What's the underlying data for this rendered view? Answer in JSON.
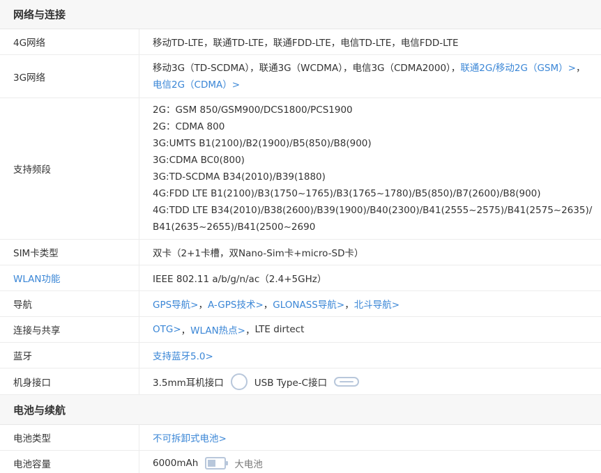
{
  "sections": {
    "network": {
      "title": "网络与连接"
    },
    "battery": {
      "title": "电池与续航"
    }
  },
  "rows": {
    "lte": {
      "label": "4G网络",
      "value": "移动TD-LTE，联通TD-LTE，联通FDD-LTE，电信TD-LTE，电信FDD-LTE"
    },
    "g3": {
      "label": "3G网络",
      "text": "移动3G（TD-SCDMA），联通3G（WCDMA），电信3G（CDMA2000），",
      "link1": "联通2G/移动2G（GSM）>",
      "sep": "，",
      "link2": "电信2G（CDMA）>"
    },
    "bands": {
      "label": "支持频段",
      "lines": [
        "2G：GSM 850/GSM900/DCS1800/PCS1900",
        "2G：CDMA 800",
        "3G:UMTS B1(2100)/B2(1900)/B5(850)/B8(900)",
        "3G:CDMA BC0(800)",
        "3G:TD-SCDMA B34(2010)/B39(1880)",
        "4G:FDD LTE B1(2100)/B3(1750~1765)/B3(1765~1780)/B5(850)/B7(2600)/B8(900)",
        "4G:TDD LTE B34(2010)/B38(2600)/B39(1900)/B40(2300)/B41(2555~2575)/B41(2575~2635)/B41(2635~2655)/B41(2500~2690"
      ]
    },
    "sim": {
      "label": "SIM卡类型",
      "value": "双卡（2+1卡槽，双Nano-Sim卡+micro-SD卡）"
    },
    "wlan": {
      "label": "WLAN功能",
      "value": "IEEE 802.11 a/b/g/n/ac（2.4+5GHz）"
    },
    "nav": {
      "label": "导航",
      "link1": "GPS导航>",
      "link2": "A-GPS技术>",
      "link3": "GLONASS导航>",
      "link4": "北斗导航>",
      "sep": "，"
    },
    "connect": {
      "label": "连接与共享",
      "link1": "OTG>",
      "link2": "WLAN热点>",
      "sep": "，",
      "text": "LTE dirtect"
    },
    "bluetooth": {
      "label": "蓝牙",
      "link": "支持蓝牙5.0>"
    },
    "ports": {
      "label": "机身接口",
      "port1": "3.5mm耳机接口",
      "port2": "USB Type-C接口"
    },
    "battery_type": {
      "label": "电池类型",
      "link": "不可拆卸式电池>"
    },
    "battery_capacity": {
      "label": "电池容量",
      "value": "6000mAh",
      "level_fraction": 0.5,
      "tag": "大电池"
    }
  },
  "icons": {
    "headphone": "headphone-jack-icon",
    "usb": "usb-type-c-icon",
    "battery": "battery-icon"
  },
  "colors": {
    "link": "#3a86d6",
    "icon": "#b8c7db"
  }
}
